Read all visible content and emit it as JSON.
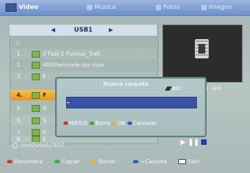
{
  "tabs": {
    "video": "Video",
    "music": "Música",
    "photo": "Fotos",
    "image": "Imagen"
  },
  "source": {
    "label": "USB1"
  },
  "list": {
    "up_dir": "/..",
    "rows": [
      {
        "num": "1.",
        "name": "2 Fast 2 Furious_Trail"
      },
      {
        "num": "2.",
        "name": "405themovie-sps.mpe"
      },
      {
        "num": "3.",
        "name": "E"
      },
      {
        "num": "4.",
        "name": "F"
      },
      {
        "num": "5.",
        "name": "S"
      },
      {
        "num": "6.",
        "name": "S"
      },
      {
        "num": "7.",
        "name": "K"
      },
      {
        "num": "8.",
        "name": "E"
      }
    ]
  },
  "preview": {
    "file_ext": "mp .avi"
  },
  "path": "/mnt/uda1/TEST",
  "dialog": {
    "title": "Nueva carpeta",
    "mode": "abc",
    "input_value": "",
    "hints": [
      {
        "label": "MAYÚS",
        "color": "#d9312c"
      },
      {
        "label": "Borra",
        "color": "#3daa3b"
      },
      {
        "label": "OK",
        "color": "#e3b52c"
      },
      {
        "label": "Cancelar",
        "color": "#2e5bc2"
      }
    ]
  },
  "legend": [
    {
      "label": "Renombra",
      "color": "#d9312c"
    },
    {
      "label": "Copiar",
      "color": "#3daa3b"
    },
    {
      "label": "Borrar",
      "color": "#e3b52c"
    },
    {
      "label": "+Carpeta",
      "color": "#2e5bc2"
    },
    {
      "label": "Salir",
      "icon": "exit-key-icon"
    }
  ]
}
